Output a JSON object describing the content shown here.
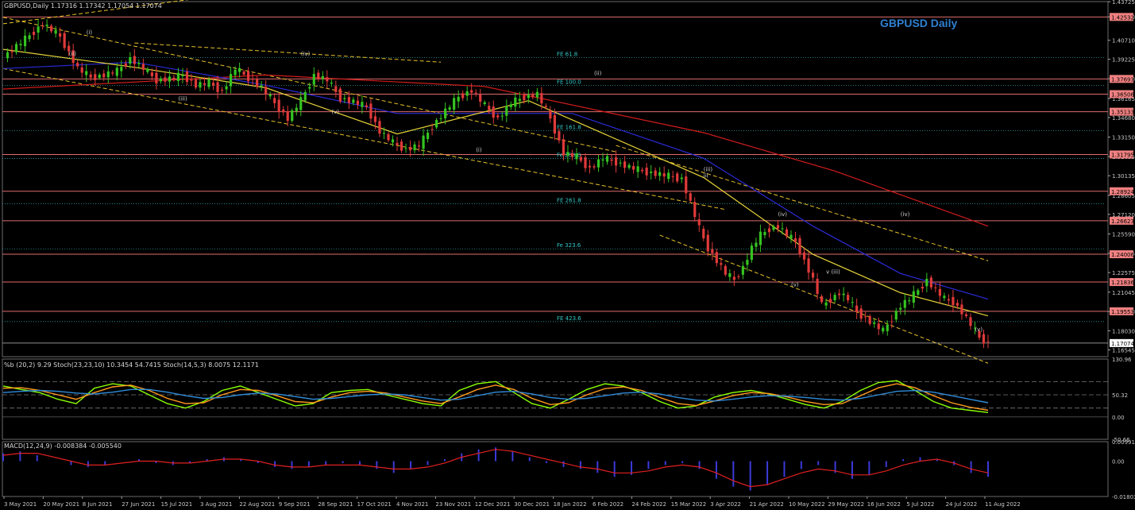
{
  "header": {
    "main": "GBPUSD,Daily  1.17316 1.17342 1.17054 1.17074",
    "stoch": "%b (20,2) 9.29  Stoch(23,23,10) 10.3454 54.7415  Stoch(14,5,3) 8.0075 12.1171",
    "macd": "MACD(12,24,9) -0.008384 -0.005540"
  },
  "chart_title": "GBPUSD Daily",
  "chart_data": {
    "type": "candlestick",
    "symbol": "GBPUSD",
    "timeframe": "Daily",
    "ohlc_last": {
      "open": 1.17316,
      "high": 1.17342,
      "low": 1.17054,
      "close": 1.17074
    },
    "price_axis_ticks": [
      "1.43725",
      "1.42540",
      "1.40710",
      "1.39225",
      "1.37710",
      "1.36165",
      "1.34680",
      "1.33150",
      "1.31635",
      "1.30135",
      "1.28605",
      "1.27120",
      "1.25590",
      "1.24075",
      "1.22575",
      "1.21045",
      "1.19530",
      "1.18030",
      "1.16545"
    ],
    "price_ylim": [
      1.1601,
      1.4373
    ],
    "resistance_levels": [
      {
        "label": "1.42532",
        "value": 1.42532
      },
      {
        "label": "1.37693",
        "value": 1.37693
      },
      {
        "label": "1.36506",
        "value": 1.36506
      },
      {
        "label": "1.35133",
        "value": 1.35133
      },
      {
        "label": "1.31795",
        "value": 1.31795
      },
      {
        "label": "1.28924",
        "value": 1.28924
      },
      {
        "label": "1.26623",
        "value": 1.26623
      },
      {
        "label": "1.24006",
        "value": 1.24006
      },
      {
        "label": "1.21836",
        "value": 1.21836
      },
      {
        "label": "1.19553",
        "value": 1.19553
      }
    ],
    "current_price_label": "1.17074",
    "fib_levels": [
      {
        "label": "FE 61.8",
        "value": 1.3935
      },
      {
        "label": "FE 100.0",
        "value": 1.3718
      },
      {
        "label": "FE 161.8",
        "value": 1.3366
      },
      {
        "label": "Fe 200.0",
        "value": 1.3148
      },
      {
        "label": "FE 261.8",
        "value": 1.2796
      },
      {
        "label": "Fe 323.6",
        "value": 1.2443
      },
      {
        "label": "FE 423.6",
        "value": 1.1875
      }
    ],
    "wave_labels": [
      "(i)",
      "(ii)",
      "(iii)",
      "(iv)",
      "(v)",
      "(i)",
      "(ii)",
      "(iii)",
      "(iv)",
      "(v)",
      "iii",
      "v (iii)",
      "(iv)",
      "(v)"
    ],
    "x_tick_labels": [
      "3 May 2021",
      "20 May 2021",
      "8 Jun 2021",
      "27 Jun 2021",
      "15 Jul 2021",
      "3 Aug 2021",
      "22 Aug 2021",
      "9 Sep 2021",
      "28 Sep 2021",
      "17 Oct 2021",
      "4 Nov 2021",
      "23 Nov 2021",
      "12 Dec 2021",
      "30 Dec 2021",
      "18 Jan 2022",
      "6 Feb 2022",
      "24 Feb 2022",
      "15 Mar 2022",
      "3 Apr 2022",
      "21 Apr 2022",
      "10 May 2022",
      "29 May 2022",
      "16 Jun 2022",
      "5 Jul 2022",
      "24 Jul 2022",
      "11 Aug 2022"
    ],
    "close_path": [
      [
        0,
        1.394
      ],
      [
        5,
        1.408
      ],
      [
        9,
        1.42
      ],
      [
        13,
        1.41
      ],
      [
        17,
        1.385
      ],
      [
        20,
        1.378
      ],
      [
        23,
        1.38
      ],
      [
        26,
        1.383
      ],
      [
        29,
        1.393
      ],
      [
        32,
        1.385
      ],
      [
        35,
        1.376
      ],
      [
        38,
        1.377
      ],
      [
        41,
        1.38
      ],
      [
        44,
        1.372
      ],
      [
        47,
        1.374
      ],
      [
        50,
        1.367
      ],
      [
        53,
        1.385
      ],
      [
        56,
        1.378
      ],
      [
        59,
        1.37
      ],
      [
        62,
        1.358
      ],
      [
        65,
        1.346
      ],
      [
        68,
        1.36
      ],
      [
        71,
        1.38
      ],
      [
        74,
        1.376
      ],
      [
        77,
        1.362
      ],
      [
        80,
        1.359
      ],
      [
        83,
        1.355
      ],
      [
        86,
        1.336
      ],
      [
        89,
        1.327
      ],
      [
        92,
        1.322
      ],
      [
        95,
        1.325
      ],
      [
        98,
        1.34
      ],
      [
        101,
        1.352
      ],
      [
        104,
        1.363
      ],
      [
        107,
        1.368
      ],
      [
        110,
        1.356
      ],
      [
        113,
        1.346
      ],
      [
        116,
        1.358
      ],
      [
        119,
        1.363
      ],
      [
        122,
        1.365
      ],
      [
        125,
        1.346
      ],
      [
        128,
        1.319
      ],
      [
        131,
        1.316
      ],
      [
        134,
        1.307
      ],
      [
        137,
        1.315
      ],
      [
        140,
        1.312
      ],
      [
        143,
        1.308
      ],
      [
        146,
        1.305
      ],
      [
        149,
        1.303
      ],
      [
        152,
        1.301
      ],
      [
        155,
        1.299
      ],
      [
        157,
        1.28
      ],
      [
        159,
        1.26
      ],
      [
        161,
        1.245
      ],
      [
        163,
        1.235
      ],
      [
        165,
        1.225
      ],
      [
        167,
        1.22
      ],
      [
        169,
        1.23
      ],
      [
        171,
        1.245
      ],
      [
        173,
        1.255
      ],
      [
        175,
        1.26
      ],
      [
        177,
        1.262
      ],
      [
        179,
        1.255
      ],
      [
        181,
        1.25
      ],
      [
        183,
        1.235
      ],
      [
        185,
        1.22
      ],
      [
        187,
        1.2
      ],
      [
        189,
        1.205
      ],
      [
        191,
        1.21
      ],
      [
        193,
        1.205
      ],
      [
        195,
        1.195
      ],
      [
        197,
        1.19
      ],
      [
        199,
        1.185
      ],
      [
        201,
        1.18
      ],
      [
        203,
        1.19
      ],
      [
        205,
        1.2
      ],
      [
        207,
        1.205
      ],
      [
        209,
        1.212
      ],
      [
        211,
        1.22
      ],
      [
        213,
        1.212
      ],
      [
        215,
        1.205
      ],
      [
        217,
        1.203
      ],
      [
        219,
        1.195
      ],
      [
        221,
        1.185
      ],
      [
        223,
        1.175
      ],
      [
        225,
        1.171
      ]
    ],
    "moving_averages": [
      {
        "color": "#d11c1c",
        "points": [
          [
            0,
            1.369
          ],
          [
            60,
            1.38
          ],
          [
            110,
            1.371
          ],
          [
            160,
            1.335
          ],
          [
            190,
            1.305
          ],
          [
            225,
            1.262
          ]
        ]
      },
      {
        "color": "#2b2bd9",
        "points": [
          [
            0,
            1.385
          ],
          [
            30,
            1.39
          ],
          [
            60,
            1.372
          ],
          [
            90,
            1.35
          ],
          [
            130,
            1.35
          ],
          [
            160,
            1.315
          ],
          [
            185,
            1.262
          ],
          [
            205,
            1.225
          ],
          [
            225,
            1.205
          ]
        ]
      },
      {
        "color": "#e8d43a",
        "points": [
          [
            0,
            1.4
          ],
          [
            30,
            1.386
          ],
          [
            60,
            1.37
          ],
          [
            90,
            1.334
          ],
          [
            120,
            1.36
          ],
          [
            160,
            1.3
          ],
          [
            185,
            1.24
          ],
          [
            205,
            1.21
          ],
          [
            225,
            1.192
          ]
        ]
      }
    ],
    "stoch_panel": {
      "axis_labels": [
        "130.96",
        "50.32",
        "0.00",
        "-50.66"
      ],
      "levels": [
        80,
        50,
        20
      ],
      "series": [
        {
          "name": "%b",
          "color": "#8aff00",
          "values": [
            70,
            62,
            55,
            40,
            30,
            65,
            75,
            70,
            50,
            30,
            20,
            35,
            60,
            70,
            55,
            40,
            25,
            30,
            55,
            60,
            62,
            50,
            40,
            30,
            25,
            60,
            75,
            80,
            55,
            30,
            20,
            40,
            62,
            75,
            70,
            55,
            35,
            20,
            25,
            45,
            55,
            60,
            52,
            40,
            28,
            20,
            35,
            60,
            78,
            82,
            60,
            35,
            20,
            15,
            10
          ]
        },
        {
          "name": "Stoch slow",
          "color": "#ff9a1f",
          "values": [
            65,
            66,
            60,
            50,
            40,
            55,
            68,
            72,
            60,
            42,
            30,
            32,
            50,
            62,
            60,
            48,
            35,
            32,
            45,
            55,
            58,
            54,
            45,
            36,
            30,
            45,
            62,
            72,
            62,
            42,
            28,
            32,
            50,
            64,
            68,
            60,
            44,
            30,
            26,
            36,
            48,
            55,
            53,
            45,
            35,
            28,
            30,
            48,
            66,
            75,
            66,
            48,
            32,
            22,
            15
          ]
        },
        {
          "name": "Stoch signal",
          "color": "#2f8bd9",
          "values": [
            55,
            58,
            60,
            58,
            54,
            52,
            56,
            62,
            62,
            56,
            48,
            42,
            44,
            50,
            54,
            52,
            46,
            40,
            42,
            46,
            50,
            52,
            50,
            44,
            38,
            40,
            48,
            56,
            58,
            52,
            44,
            40,
            42,
            48,
            54,
            56,
            52,
            44,
            38,
            36,
            40,
            45,
            48,
            47,
            44,
            40,
            38,
            42,
            50,
            58,
            60,
            56,
            48,
            40,
            32
          ]
        }
      ]
    },
    "macd_panel": {
      "axis_labels": [
        "0.009912",
        "0.00",
        "-0.018030"
      ],
      "ylim": [
        -0.01803,
        0.009912
      ],
      "values": [
        0.004,
        0.005,
        0.003,
        0.0,
        -0.002,
        -0.003,
        -0.002,
        0.0,
        0.001,
        -0.001,
        -0.002,
        -0.001,
        0.001,
        0.002,
        0.001,
        -0.001,
        -0.003,
        -0.004,
        -0.003,
        -0.002,
        -0.001,
        -0.002,
        -0.004,
        -0.006,
        -0.004,
        -0.002,
        0.001,
        0.004,
        0.006,
        0.007,
        0.005,
        0.002,
        -0.001,
        -0.003,
        -0.004,
        -0.006,
        -0.008,
        -0.007,
        -0.004,
        -0.002,
        -0.001,
        -0.004,
        -0.009,
        -0.013,
        -0.015,
        -0.012,
        -0.008,
        -0.004,
        -0.002,
        -0.006,
        -0.009,
        -0.007,
        -0.003,
        0.001,
        0.002,
        0.001,
        -0.002,
        -0.006,
        -0.008
      ],
      "signal": [
        0.003,
        0.004,
        0.004,
        0.002,
        0.0,
        -0.002,
        -0.002,
        -0.001,
        0.0,
        0.0,
        -0.001,
        -0.001,
        0.0,
        0.001,
        0.001,
        0.0,
        -0.002,
        -0.003,
        -0.003,
        -0.002,
        -0.002,
        -0.002,
        -0.003,
        -0.004,
        -0.004,
        -0.003,
        -0.001,
        0.002,
        0.004,
        0.006,
        0.005,
        0.003,
        0.001,
        -0.001,
        -0.003,
        -0.004,
        -0.006,
        -0.006,
        -0.005,
        -0.003,
        -0.002,
        -0.003,
        -0.006,
        -0.01,
        -0.013,
        -0.012,
        -0.009,
        -0.006,
        -0.004,
        -0.005,
        -0.007,
        -0.007,
        -0.005,
        -0.002,
        0.0,
        0.001,
        -0.001,
        -0.004,
        -0.006
      ]
    }
  }
}
